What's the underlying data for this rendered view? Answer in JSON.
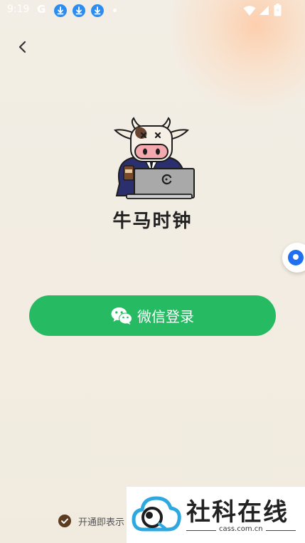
{
  "status_bar": {
    "time": "9:19",
    "google_label": "G"
  },
  "icons": {
    "back": "chevron-left-icon",
    "float": "assistant-bubble-icon",
    "wechat": "wechat-icon",
    "checkbox": "checked-circle-icon"
  },
  "app": {
    "title": "牛马时钟"
  },
  "login": {
    "wechat_label": "微信登录"
  },
  "agreement": {
    "text": "开通即表示"
  },
  "watermark": {
    "title": "社科在线",
    "url": "cass.com.cn"
  },
  "colors": {
    "primary_green": "#26bb63",
    "background": "#f1ebdf",
    "checkbox_brown": "#5b3b22",
    "float_blue": "#1f6ff0"
  }
}
